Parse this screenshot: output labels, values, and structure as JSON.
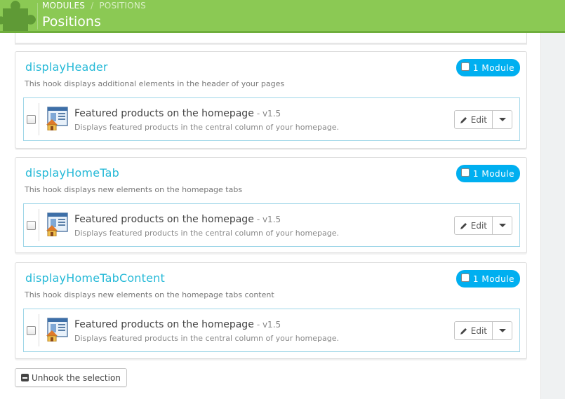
{
  "header": {
    "breadcrumb": [
      "MODULES",
      "POSITIONS"
    ],
    "breadcrumb_sep": "/",
    "title": "Positions"
  },
  "hooks": [
    {
      "name": "displayHeader",
      "description": "This hook displays additional elements in the header of your pages",
      "badge_label": "1 Module",
      "module": {
        "title": "Featured products on the homepage",
        "version": "- v1.5",
        "description": "Displays featured products in the central column of your homepage.",
        "edit_label": "Edit"
      }
    },
    {
      "name": "displayHomeTab",
      "description": "This hook displays new elements on the homepage tabs",
      "badge_label": "1 Module",
      "module": {
        "title": "Featured products on the homepage",
        "version": "- v1.5",
        "description": "Displays featured products in the central column of your homepage.",
        "edit_label": "Edit"
      }
    },
    {
      "name": "displayHomeTabContent",
      "description": "This hook displays new elements on the homepage tabs content",
      "badge_label": "1 Module",
      "module": {
        "title": "Featured products on the homepage",
        "version": "- v1.5",
        "description": "Displays featured products in the central column of your homepage.",
        "edit_label": "Edit"
      }
    }
  ],
  "actions": {
    "unhook_label": "Unhook the selection"
  },
  "icons": {
    "header": "puzzle-piece-icon",
    "edit": "pencil-icon",
    "dropdown": "caret-down-icon",
    "unhook": "minus-square-icon",
    "module": "module-house-icon"
  },
  "colors": {
    "header_green": "#8bc954",
    "accent_blue": "#25b9d7",
    "badge_blue": "#00aff0",
    "row_border": "#9fd6e8"
  }
}
